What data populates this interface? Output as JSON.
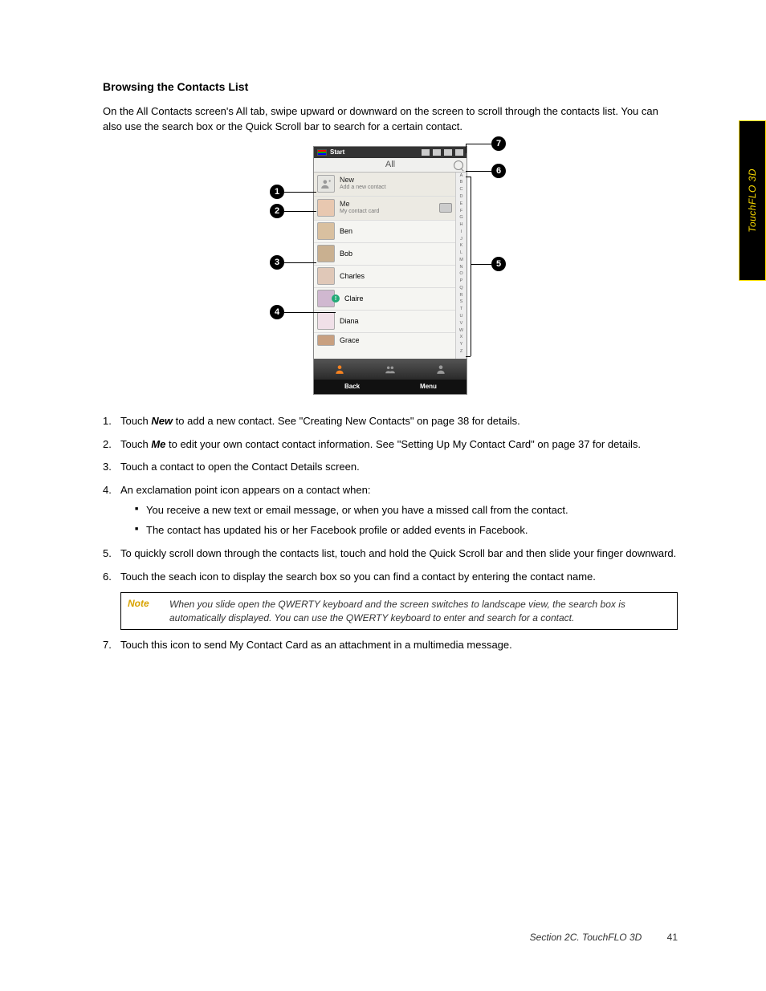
{
  "sideTab": "TouchFLO 3D",
  "heading": "Browsing the Contacts List",
  "intro": "On the All Contacts screen's All tab, swipe upward or downward on the screen to scroll through the contacts list. You can also use the search box or the Quick Scroll bar to search for a certain contact.",
  "phone": {
    "start": "Start",
    "title": "All",
    "rows": {
      "newTitle": "New",
      "newSub": "Add a new contact",
      "meTitle": "Me",
      "meSub": "My contact card",
      "c1": "Ben",
      "c2": "Bob",
      "c3": "Charles",
      "c4": "Claire",
      "c5": "Diana",
      "c6": "Grace"
    },
    "az": [
      "A",
      "B",
      "C",
      "D",
      "E",
      "F",
      "G",
      "H",
      "I",
      "J",
      "K",
      "L",
      "M",
      "N",
      "O",
      "P",
      "Q",
      "R",
      "S",
      "T",
      "U",
      "V",
      "W",
      "X",
      "Y",
      "Z"
    ],
    "softLeft": "Back",
    "softRight": "Menu"
  },
  "callouts": {
    "1": "1",
    "2": "2",
    "3": "3",
    "4": "4",
    "5": "5",
    "6": "6",
    "7": "7"
  },
  "list": {
    "i1a": "Touch ",
    "i1b": "New",
    "i1c": " to add a new contact. See \"Creating New Contacts\" on page 38 for details.",
    "i2a": "Touch ",
    "i2b": "Me",
    "i2c": " to edit your own contact contact information. See \"Setting Up My Contact Card\" on page 37 for details.",
    "i3": "Touch a contact to open the Contact Details screen.",
    "i4": "An exclamation point icon appears on a contact when:",
    "i4s1": "You receive a new text or email message, or when you have a missed call from the contact.",
    "i4s2": "The contact has updated his or her Facebook profile or added events in Facebook.",
    "i5": "To quickly scroll down through the contacts list, touch and hold the Quick Scroll bar and then slide your finger downward.",
    "i6": "Touch the seach icon to display the search box so you can find a contact by entering the contact name.",
    "noteLabel": "Note",
    "noteText": "When you slide open the QWERTY keyboard and the screen switches to landscape view, the search box is automatically displayed. You can use the QWERTY keyboard to enter and search for a contact.",
    "i7": "Touch this icon to send My Contact Card as an attachment in a multimedia message."
  },
  "footer": {
    "section": "Section 2C. TouchFLO 3D",
    "page": "41"
  }
}
